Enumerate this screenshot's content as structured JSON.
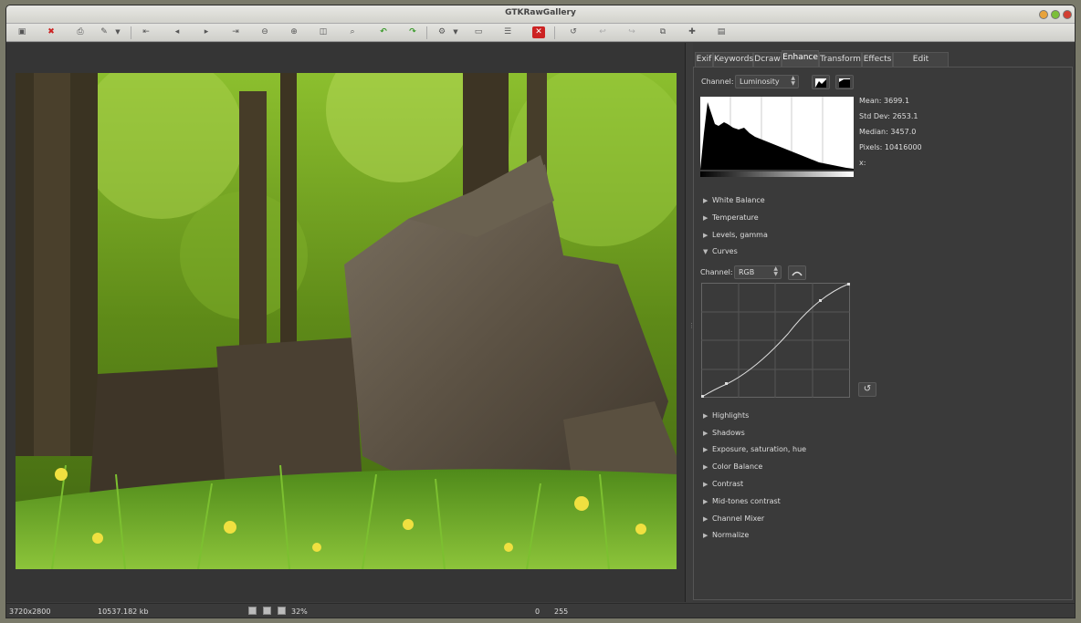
{
  "window": {
    "title": "GTKRawGallery"
  },
  "toolbar": {
    "icons": [
      "open-icon",
      "delete-icon",
      "print-icon",
      "edit-icon",
      "menu-arrow-icon",
      "first-icon",
      "prev-icon",
      "next-icon",
      "last-icon",
      "zoom-out-icon",
      "zoom-in-icon",
      "zoom-fit-icon",
      "zoom-100-icon",
      "rotate-left-icon",
      "rotate-right-icon",
      "settings-icon",
      "settings-arrow-icon",
      "screen-icon",
      "list-icon",
      "close-red-icon",
      "undo-icon",
      "undo2-icon",
      "redo-icon",
      "compare-icon",
      "add-icon",
      "export-icon"
    ]
  },
  "tabs": [
    "Exif",
    "Keywords",
    "Dcraw",
    "Enhance",
    "Transform",
    "Effects",
    "Edit Metadata"
  ],
  "active_tab": "Enhance",
  "histogram": {
    "channel_label": "Channel:",
    "channel_value": "Luminosity",
    "stats": {
      "mean": "Mean: 3699.1",
      "std_dev": "Std Dev: 2653.1",
      "median": "Median: 3457.0",
      "pixels": "Pixels: 10416000",
      "x": "x:"
    }
  },
  "sections_top": [
    "White Balance",
    "Temperature",
    "Levels, gamma"
  ],
  "curves": {
    "label": "Curves",
    "channel_label": "Channel:",
    "channel_value": "RGB"
  },
  "sections_bottom": [
    "Highlights",
    "Shadows",
    "Exposure, saturation, hue",
    "Color Balance",
    "Contrast",
    "Mid-tones contrast",
    "Channel Mixer",
    "Normalize"
  ],
  "status": {
    "dimensions": "3720x2800",
    "filesize": "10537.182 kb",
    "zoom": "32%",
    "value_min": "0",
    "value_max": "255"
  },
  "colors": {
    "accent_green": "#3a9a2a",
    "accent_red": "#cc2222"
  }
}
